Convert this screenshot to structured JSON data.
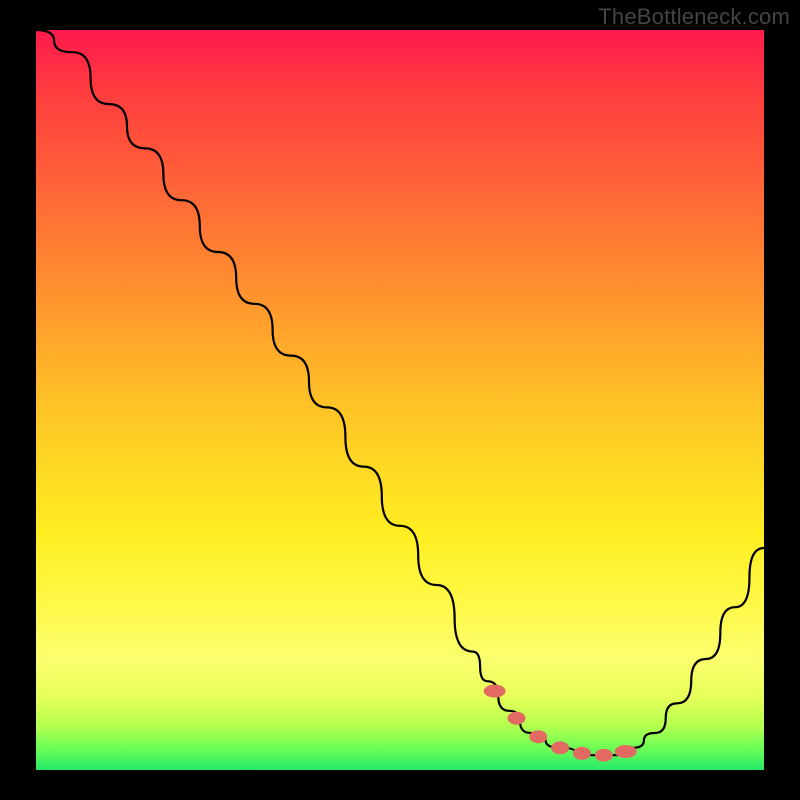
{
  "watermark": "TheBottleneck.com",
  "chart_data": {
    "type": "line",
    "title": "",
    "xlabel": "",
    "ylabel": "",
    "xlim": [
      0,
      100
    ],
    "ylim": [
      0,
      100
    ],
    "grid": false,
    "legend": false,
    "series": [
      {
        "name": "bottleneck-curve",
        "x": [
          0,
          5,
          10,
          15,
          20,
          25,
          30,
          35,
          40,
          45,
          50,
          55,
          60,
          62,
          65,
          68,
          72,
          76,
          80,
          82,
          85,
          88,
          92,
          96,
          100
        ],
        "values": [
          100,
          97,
          90,
          84,
          77,
          70,
          63,
          56,
          49,
          41,
          33,
          25,
          16,
          12,
          8,
          5,
          3,
          2,
          2,
          3,
          5,
          9,
          15,
          22,
          30
        ]
      }
    ],
    "optimum_band_x": [
      62,
      82
    ],
    "markers_x": [
      63,
      66,
      69,
      72,
      75,
      78,
      81
    ],
    "background_gradient": {
      "top": "#ff1a4d",
      "mid": "#ffee22",
      "bottom": "#25e86a"
    }
  }
}
